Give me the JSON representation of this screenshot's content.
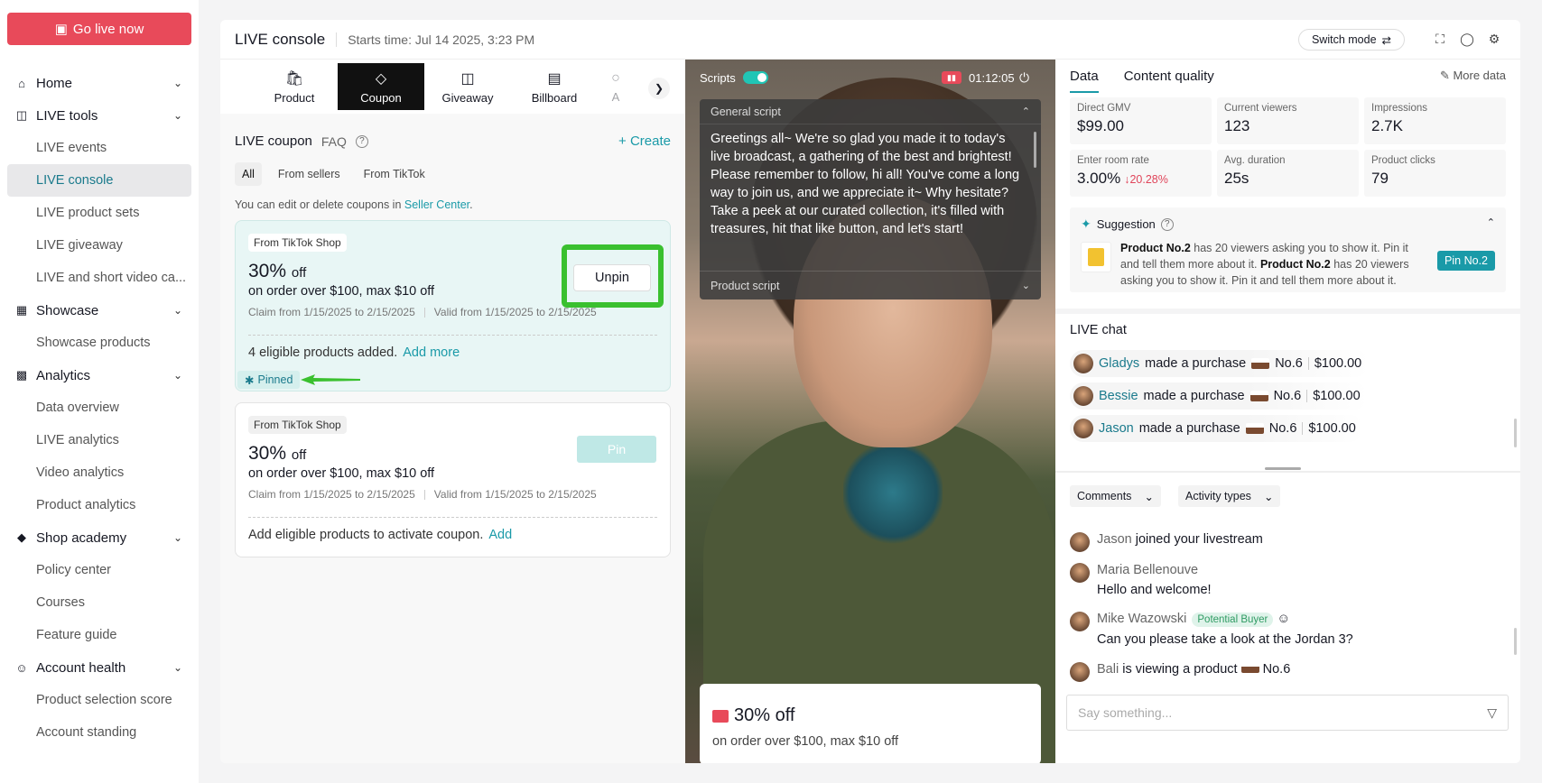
{
  "sidebar": {
    "go_live": "Go live now",
    "items": [
      {
        "label": "Home",
        "type": "top",
        "icon": "home-icon"
      },
      {
        "label": "LIVE tools",
        "type": "top",
        "icon": "live-tools-icon"
      },
      {
        "label": "LIVE events",
        "type": "sub"
      },
      {
        "label": "LIVE console",
        "type": "sub",
        "active": true
      },
      {
        "label": "LIVE product sets",
        "type": "sub"
      },
      {
        "label": "LIVE giveaway",
        "type": "sub"
      },
      {
        "label": "LIVE and short video ca...",
        "type": "sub"
      },
      {
        "label": "Showcase",
        "type": "top",
        "icon": "showcase-icon"
      },
      {
        "label": "Showcase products",
        "type": "sub"
      },
      {
        "label": "Analytics",
        "type": "top",
        "icon": "analytics-icon"
      },
      {
        "label": "Data overview",
        "type": "sub"
      },
      {
        "label": "LIVE analytics",
        "type": "sub"
      },
      {
        "label": "Video analytics",
        "type": "sub"
      },
      {
        "label": "Product analytics",
        "type": "sub"
      },
      {
        "label": "Shop academy",
        "type": "top",
        "icon": "academy-icon"
      },
      {
        "label": "Policy center",
        "type": "sub"
      },
      {
        "label": "Courses",
        "type": "sub"
      },
      {
        "label": "Feature guide",
        "type": "sub"
      },
      {
        "label": "Account health",
        "type": "top",
        "icon": "account-icon"
      },
      {
        "label": "Product selection score",
        "type": "sub"
      },
      {
        "label": "Account standing",
        "type": "sub"
      }
    ]
  },
  "header": {
    "title": "LIVE console",
    "start_time": "Starts time: Jul 14 2025, 3:23 PM",
    "switch_mode": "Switch mode"
  },
  "tools": {
    "tabs": [
      {
        "label": "Product",
        "icon": "bag-icon"
      },
      {
        "label": "Coupon",
        "icon": "coupon-icon",
        "active": true
      },
      {
        "label": "Giveaway",
        "icon": "gift-icon"
      },
      {
        "label": "Billboard",
        "icon": "billboard-icon"
      },
      {
        "label": "A",
        "icon": "more-icon"
      }
    ]
  },
  "coupon": {
    "heading": "LIVE coupon",
    "faq": "FAQ",
    "create": "Create",
    "filters": [
      "All",
      "From sellers",
      "From TikTok"
    ],
    "note_prefix": "You can edit or delete coupons in ",
    "note_link": "Seller Center",
    "note_suffix": ".",
    "cards": [
      {
        "source": "From TikTok Shop",
        "pct": "30%",
        "off": "off",
        "condition": "on order over $100, max $10 off",
        "claim": "Claim from 1/15/2025 to 2/15/2025",
        "valid": "Valid from 1/15/2025 to 2/15/2025",
        "eligible": "4 eligible products added.",
        "action_link": "Add more",
        "button": "Unpin",
        "pinned": "Pinned"
      },
      {
        "source": "From TikTok Shop",
        "pct": "30%",
        "off": "off",
        "condition": "on order over $100, max $10 off",
        "claim": "Claim from 1/15/2025 to 2/15/2025",
        "valid": "Valid from 1/15/2025 to 2/15/2025",
        "eligible": "Add eligible products to activate coupon.",
        "action_link": "Add",
        "button": "Pin"
      }
    ]
  },
  "stream": {
    "scripts_label": "Scripts",
    "timer": "01:12:05",
    "general_script": "General script",
    "script_text": "Greetings all~ We're so glad you made it to today's live broadcast, a gathering of the best and brightest! Please remember to follow, hi all! You've come a long way to join us, and we appreciate it~ Why hesitate? Take a peek at our curated collection, it's filled with treasures, hit that like button, and let's start!",
    "product_script": "Product script",
    "promo_title": "30% off",
    "promo_sub": "on order over $100, max $10 off"
  },
  "data": {
    "tabs": [
      "Data",
      "Content quality"
    ],
    "more_data": "More data",
    "metrics": [
      {
        "label": "Direct GMV",
        "value": "$99.00"
      },
      {
        "label": "Current viewers",
        "value": "123"
      },
      {
        "label": "Impressions",
        "value": "2.7K"
      },
      {
        "label": "Enter room rate",
        "value": "3.00%",
        "change": "20.28%"
      },
      {
        "label": "Avg. duration",
        "value": "25s"
      },
      {
        "label": "Product clicks",
        "value": "79"
      }
    ],
    "suggestion": {
      "title": "Suggestion",
      "p1": "Product No.2",
      "t1": " has 20 viewers asking you to show it. Pin it and tell them more about it. ",
      "p2": "Product No.2",
      "t2": " has 20 viewers asking you to show it. Pin it and tell them more about it.",
      "button": "Pin No.2"
    }
  },
  "chat": {
    "title": "LIVE chat",
    "purchases": [
      {
        "name": "Gladys",
        "action": "made a purchase",
        "product": "No.6",
        "amount": "$100.00"
      },
      {
        "name": "Bessie",
        "action": "made a purchase",
        "product": "No.6",
        "amount": "$100.00"
      },
      {
        "name": "Jason",
        "action": "made a purchase",
        "product": "No.6",
        "amount": "$100.00"
      }
    ],
    "dropdowns": [
      "Comments",
      "Activity types"
    ],
    "join": {
      "name": "Jason",
      "text": "joined your livestream"
    },
    "comments": [
      {
        "name": "Maria Bellenouve",
        "text": "Hello and welcome!"
      },
      {
        "name": "Mike Wazowski",
        "tag": "Potential Buyer",
        "text": "Can you please take a look at the Jordan 3?"
      }
    ],
    "viewing": {
      "name": "Bali",
      "text": "is viewing a product",
      "product": "No.6"
    },
    "placeholder": "Say something..."
  }
}
